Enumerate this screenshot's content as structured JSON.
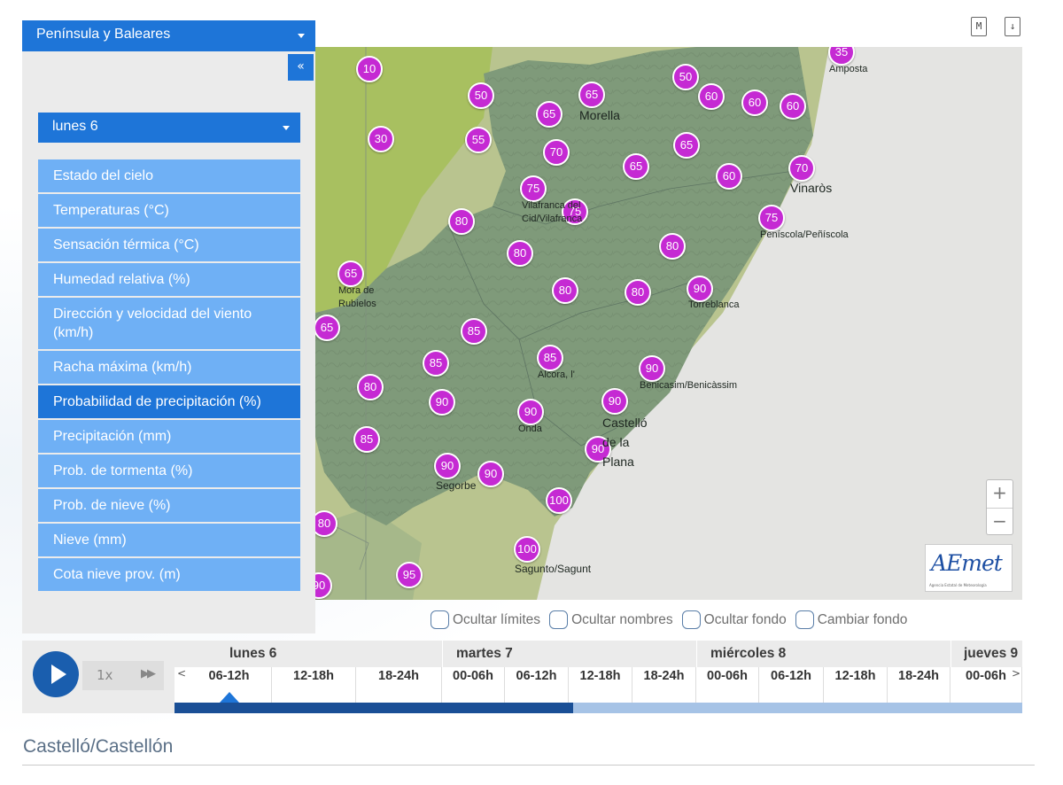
{
  "selectors": {
    "region": "Península y Baleares",
    "collapse": "«",
    "day": "lunes 6"
  },
  "menu": [
    "Estado del cielo",
    "Temperaturas (°C)",
    "Sensación térmica (°C)",
    "Humedad relativa (%)",
    "Dirección y velocidad del viento (km/h)",
    "Racha máxima (km/h)",
    "Probabilidad de precipitación (%)",
    "Precipitación (mm)",
    "Prob. de tormenta (%)",
    "Prob. de nieve (%)",
    "Nieve (mm)",
    "Cota nieve prov. (m)"
  ],
  "active_menu_index": 6,
  "top_icons": [
    "M",
    "↓"
  ],
  "map": {
    "badges": [
      "35",
      "10",
      "50",
      "65",
      "50",
      "60",
      "60",
      "60",
      "65",
      "55",
      "30",
      "70",
      "65",
      "65",
      "60",
      "70",
      "75",
      "75",
      "80",
      "75",
      "80",
      "80",
      "65",
      "80",
      "80",
      "90",
      "65",
      "85",
      "85",
      "85",
      "90",
      "80",
      "90",
      "90",
      "90",
      "85",
      "90",
      "90",
      "90",
      "100",
      "80",
      "100",
      "95",
      "90"
    ],
    "places": [
      "Amposta",
      "Morella",
      "Vinaròs",
      "Vilafranca del Cid/Vilafranca",
      "Peníscola/Peñíscola",
      "Mora de Rubielos",
      "Torreblanca",
      "Alcora, l'",
      "Benicasim/Benicàssim",
      "Onda",
      "Castelló de la Plana",
      "Segorbe",
      "Sagunto/Sagunt"
    ],
    "zoom_in": "+",
    "zoom_out": "−",
    "logo": "AEmet",
    "logo_sub": "Agencia Estatal de Meteorología"
  },
  "checkboxes": [
    "Ocultar límites",
    "Ocultar nombres",
    "Ocultar fondo",
    "Cambiar fondo"
  ],
  "timeline": {
    "speed": "1x",
    "ff": "▶▶",
    "prev": "<",
    "next": ">",
    "days": [
      "lunes 6",
      "martes 7",
      "miércoles 8",
      "jueves 9"
    ],
    "slots": [
      "06-12h",
      "12-18h",
      "18-24h",
      "00-06h",
      "06-12h",
      "12-18h",
      "18-24h",
      "00-06h",
      "06-12h",
      "12-18h",
      "18-24h",
      "00-06h"
    ],
    "selected_slot": 0,
    "progress": 0.47
  },
  "location_title": "Castelló/Castellón"
}
